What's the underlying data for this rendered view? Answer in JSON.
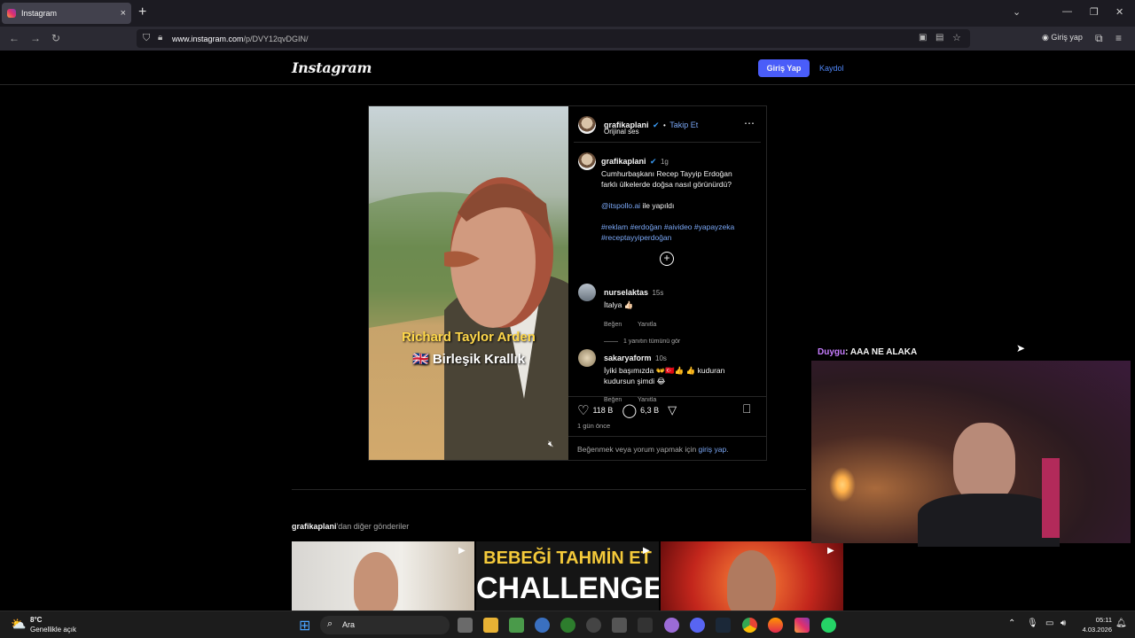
{
  "browser": {
    "tab_title": "Instagram",
    "tab_close": "×",
    "new_tab": "+",
    "url_prefix": "www.instagram.com",
    "url_path": "/p/DVY12qvDGIN/",
    "signin_label": "Giriş yap"
  },
  "header": {
    "logo": "Instagram",
    "login_button": "Giriş Yap",
    "signup_link": "Kaydol"
  },
  "post": {
    "author": "grafikaplani",
    "follow": "Takip Et",
    "dot": "•",
    "audio": "Orijinal ses",
    "overlay_name": "Richard Taylor Arden",
    "overlay_country_flag": "🇬🇧",
    "overlay_country": "Birleşik Krallık",
    "caption_time": "1g",
    "caption_line1": "Cumhurbaşkanı Recep Tayyip Erdoğan",
    "caption_line2": "farklı ülkelerde doğsa nasıl görünürdü?",
    "credit_mention": "@itspollo.ai",
    "credit_suffix": "ile yapıldı",
    "hashtags_line1": "#reklam #erdoğan #aivideo #yapayzeka",
    "hashtags_line2": "#receptayyiperdoğan",
    "likes": "118 B",
    "comments_count": "6,3 B",
    "posted": "1 gün önce",
    "login_prompt_prefix": "Beğenmek veya yorum yapmak için",
    "login_prompt_link": "giriş yap",
    "login_prompt_suffix": "."
  },
  "comments": [
    {
      "user": "nurselaktas",
      "time": "15s",
      "text": "İtalya 👍🏻",
      "like": "Beğen",
      "reply": "Yanıtla",
      "replies": "1 yanıtın tümünü gör"
    },
    {
      "user": "sakaryaform",
      "time": "10s",
      "text": "İyiki başımızda 👐🇹🇷👍 👍 kuduran",
      "text2": "kudursun şimdi 😂",
      "like": "Beğen",
      "reply": "Yanıtla"
    }
  ],
  "overlay_chat": {
    "user": "Duygu",
    "message": ": AAA NE ALAKA"
  },
  "more_posts": {
    "author": "grafikaplani",
    "suffix": "'dan diğer gönderiler",
    "thumb2_line1": "BEBEĞİ TAHMİN ET",
    "thumb2_line2": "CHALLENGE"
  },
  "taskbar": {
    "weather_temp": "8°C",
    "weather_desc": "Genellikle açık",
    "search": "Ara",
    "time": "05:11",
    "date": "4.03.2026"
  },
  "colors": {
    "accent": "#4a5df9",
    "link": "#7aa7f5",
    "chat_user": "#c77dff"
  }
}
